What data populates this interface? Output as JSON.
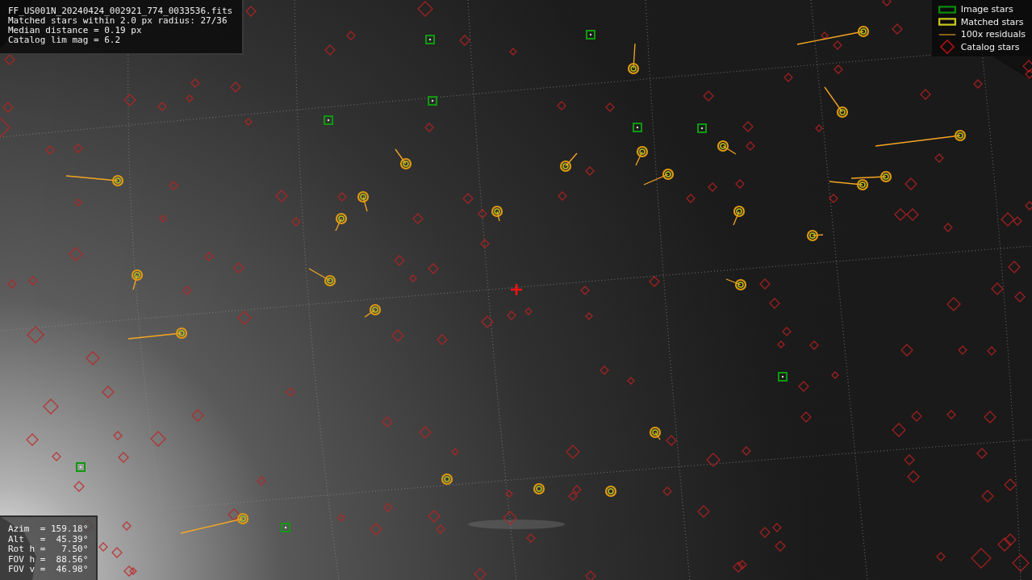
{
  "info_panel": {
    "lines": [
      "FF_US001N_20240424_002921_774_0033536.fits",
      "Matched stars within 2.0 px radius: 27/36",
      "Median distance = 0.19 px",
      "Catalog lim mag = 6.2"
    ]
  },
  "legend": [
    {
      "label": "Image stars"
    },
    {
      "kind": "matched",
      "label": "Matched stars"
    },
    {
      "kind": "residual",
      "label": "100x residuals"
    },
    {
      "kind": "catalog",
      "label": "Catalog stars"
    }
  ],
  "pointing_panel": {
    "lines": [
      "Azim  = 159.18°",
      "Alt   =  45.39°",
      "Rot h =   7.50°",
      "FOV h =  88.56°",
      "FOV v =  46.98°"
    ]
  }
}
